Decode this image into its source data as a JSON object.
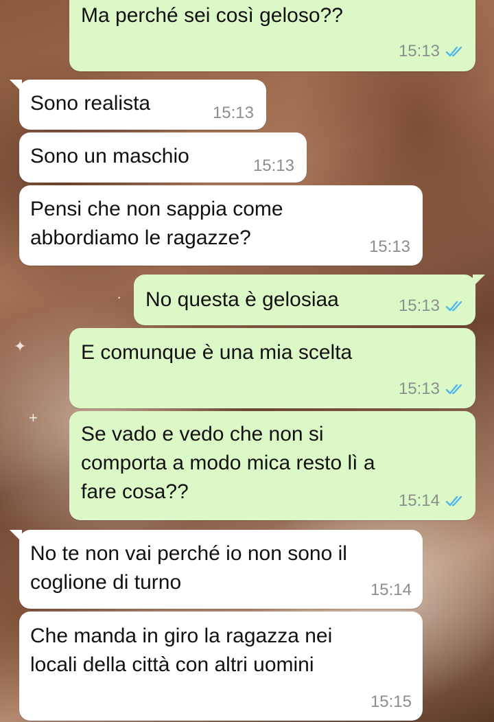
{
  "chat": {
    "messages": [
      {
        "direction": "outgoing",
        "text_lines": [
          "Ma perché sei così geloso??"
        ],
        "time": "15:13",
        "status": "read"
      },
      {
        "direction": "incoming",
        "text_lines": [
          "Sono realista"
        ],
        "time": "15:13"
      },
      {
        "direction": "incoming",
        "text_lines": [
          "Sono un maschio"
        ],
        "time": "15:13"
      },
      {
        "direction": "incoming",
        "text_lines": [
          "Pensi che non sappia come",
          "abbordiamo le ragazze?"
        ],
        "time": "15:13"
      },
      {
        "direction": "outgoing",
        "text_lines": [
          "No questa è gelosiaa"
        ],
        "time": "15:13",
        "status": "read"
      },
      {
        "direction": "outgoing",
        "text_lines": [
          "E comunque è una mia scelta"
        ],
        "time": "15:13",
        "status": "read"
      },
      {
        "direction": "outgoing",
        "text_lines": [
          "Se vado e vedo che non si",
          "comporta a modo mica resto lì a",
          "fare cosa??"
        ],
        "time": "15:14",
        "status": "read"
      },
      {
        "direction": "incoming",
        "text_lines": [
          "No te non vai perché io non sono il",
          "coglione di turno"
        ],
        "time": "15:14"
      },
      {
        "direction": "incoming",
        "text_lines": [
          "Che manda in giro la ragazza nei",
          "locali della città con altri uomini"
        ],
        "time": "15:15"
      }
    ]
  },
  "colors": {
    "outgoing_bubble": "#dcf8c6",
    "incoming_bubble": "#ffffff",
    "read_ticks": "#4fb6ec",
    "timestamp": "#8a8f8c"
  },
  "icons": {
    "read_status": "double-check-icon"
  }
}
